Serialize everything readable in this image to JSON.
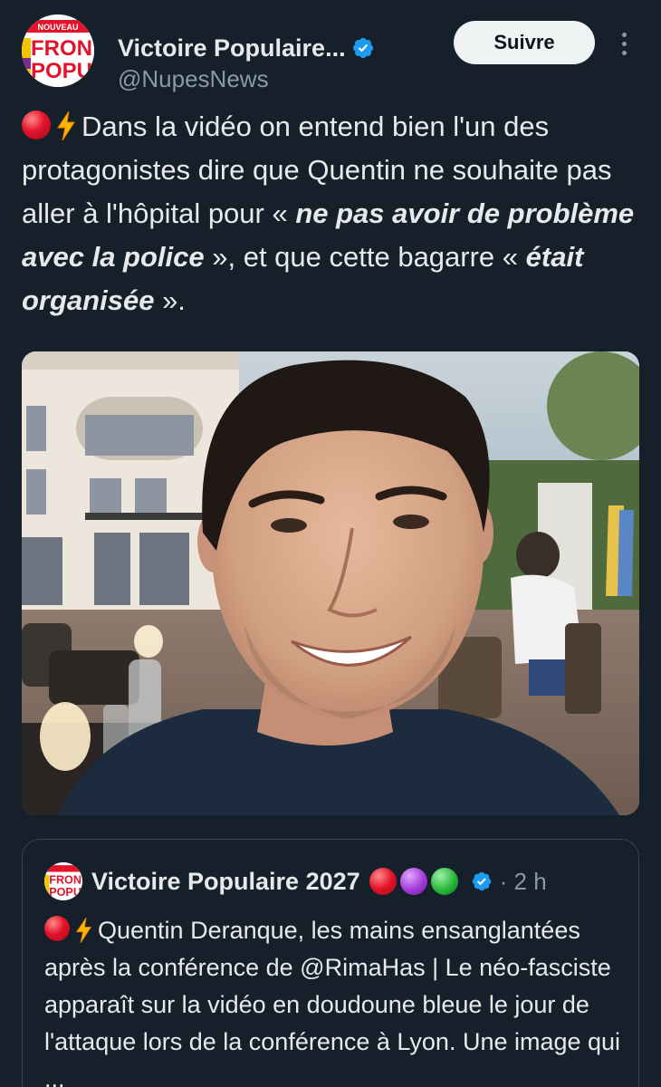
{
  "author": {
    "display_name": "Victoire Populaire...",
    "handle": "@NupesNews",
    "avatar_text": [
      "NOUVEAU",
      "FRON",
      "POPU"
    ]
  },
  "follow_label": "Suivre",
  "tweet": {
    "part1": "Dans la vidéo on entend bien l'un des protagonistes dire que Quentin ne souhaite pas aller à l'hôpital pour « ",
    "em1": "ne pas avoir de problème avec la police",
    "part2": " », et que cette bagarre « ",
    "em2": "était organisée",
    "part3": " »."
  },
  "quoted": {
    "display_name": "Victoire Populaire 2027",
    "time": "· 2 h",
    "text": "Quentin Deranque, les mains ensanglantées après la conférence de @RimaHas | Le néo-fasciste apparaît sur la vidéo en doudoune bleue le jour de l'attaque lors de la conférence à Lyon. Une image qui ..."
  },
  "icons": {
    "verified": "verified-badge-icon",
    "more": "more-options-icon",
    "red_circle": "red-circle-emoji",
    "bolt": "high-voltage-emoji",
    "purple_circle": "purple-circle-emoji",
    "green_circle": "green-circle-emoji"
  },
  "colors": {
    "background": "#15202b",
    "text": "#e7e9ea",
    "secondary": "#8b98a5",
    "verified": "#1d9bf0",
    "border": "#38444d",
    "follow_bg": "#eff3f4"
  }
}
